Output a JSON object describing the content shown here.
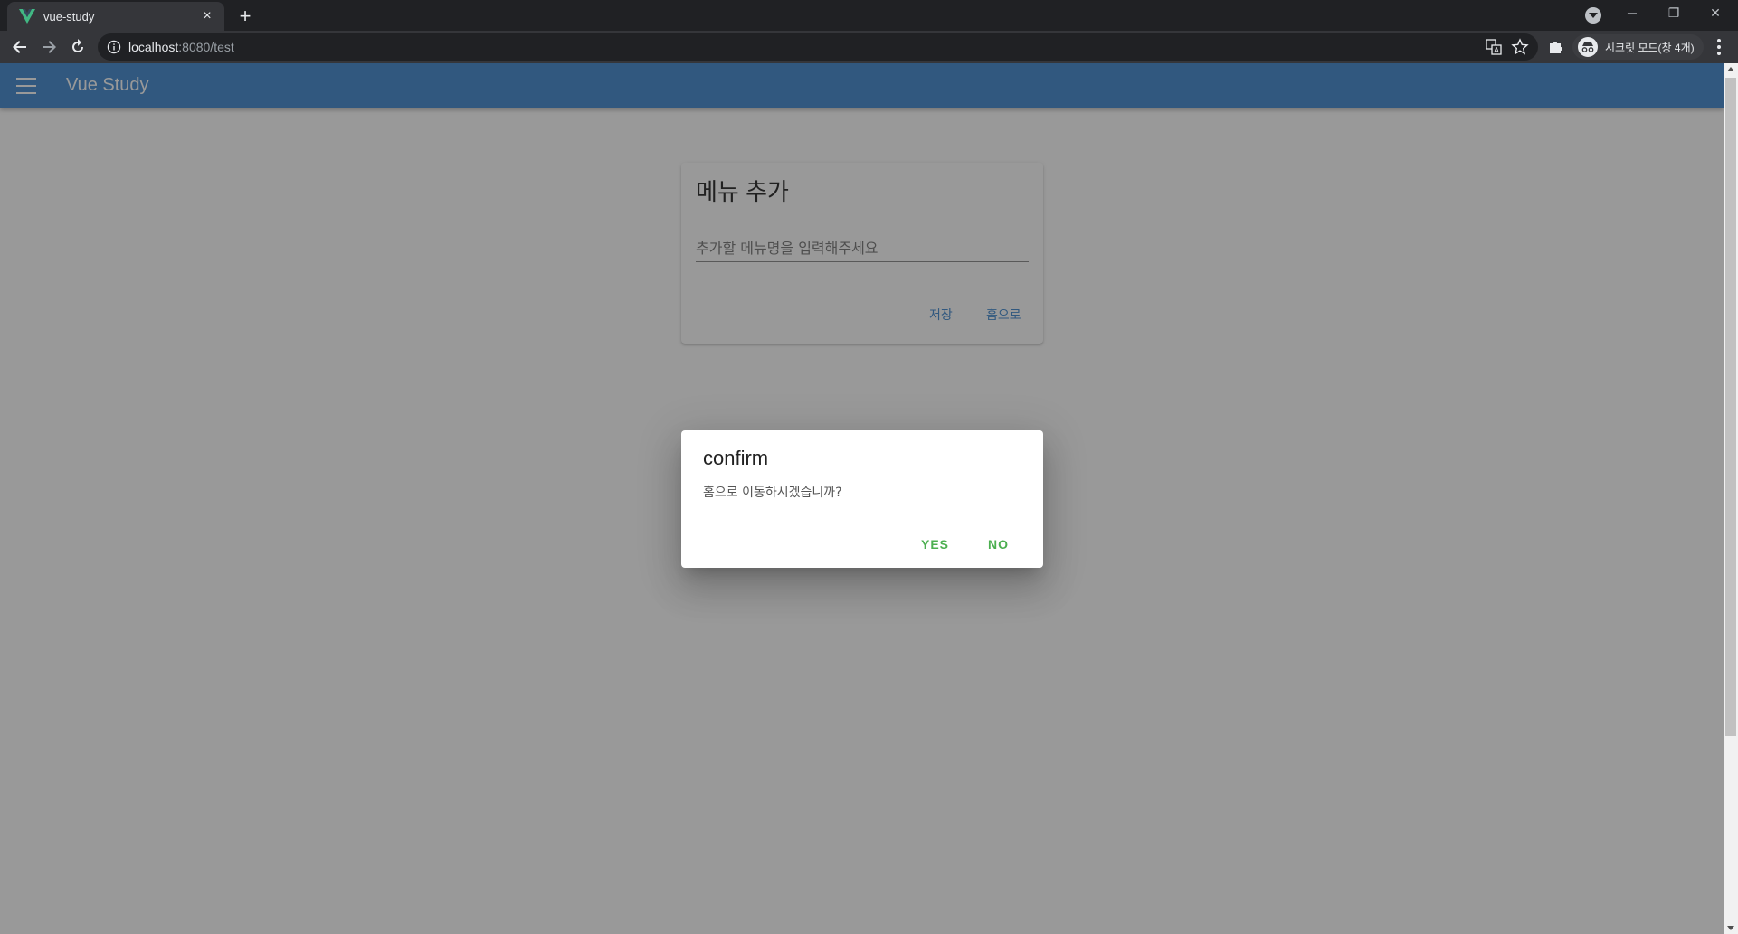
{
  "browser": {
    "tab_title": "vue-study",
    "tab_close": "×",
    "new_tab": "+",
    "url_host": "localhost",
    "url_rest": ":8080/test",
    "profile_label": "시크릿 모드(창 4개)",
    "window_minimize": "─",
    "window_restore": "❐",
    "window_close": "✕"
  },
  "app": {
    "title": "Vue Study",
    "accent_color": "#3f88cf"
  },
  "card": {
    "title": "메뉴 추가",
    "input_placeholder": "추가할 메뉴명을 입력해주세요",
    "input_value": "",
    "save_label": "저장",
    "home_label": "홈으로"
  },
  "dialog": {
    "title": "confirm",
    "message": "홈으로 이동하시겠습니까?",
    "yes_label": "YES",
    "no_label": "NO",
    "button_color": "#4caf50"
  },
  "icons": {
    "favicon": "vue-logo-icon",
    "back": "arrow-left-icon",
    "forward": "arrow-right-icon",
    "reload": "reload-icon",
    "info": "info-icon",
    "translate": "translate-icon",
    "bookmark": "star-icon",
    "extensions": "puzzle-icon",
    "incognito": "incognito-icon",
    "menu": "more-vert-icon",
    "nav_drawer": "hamburger-menu-icon"
  }
}
